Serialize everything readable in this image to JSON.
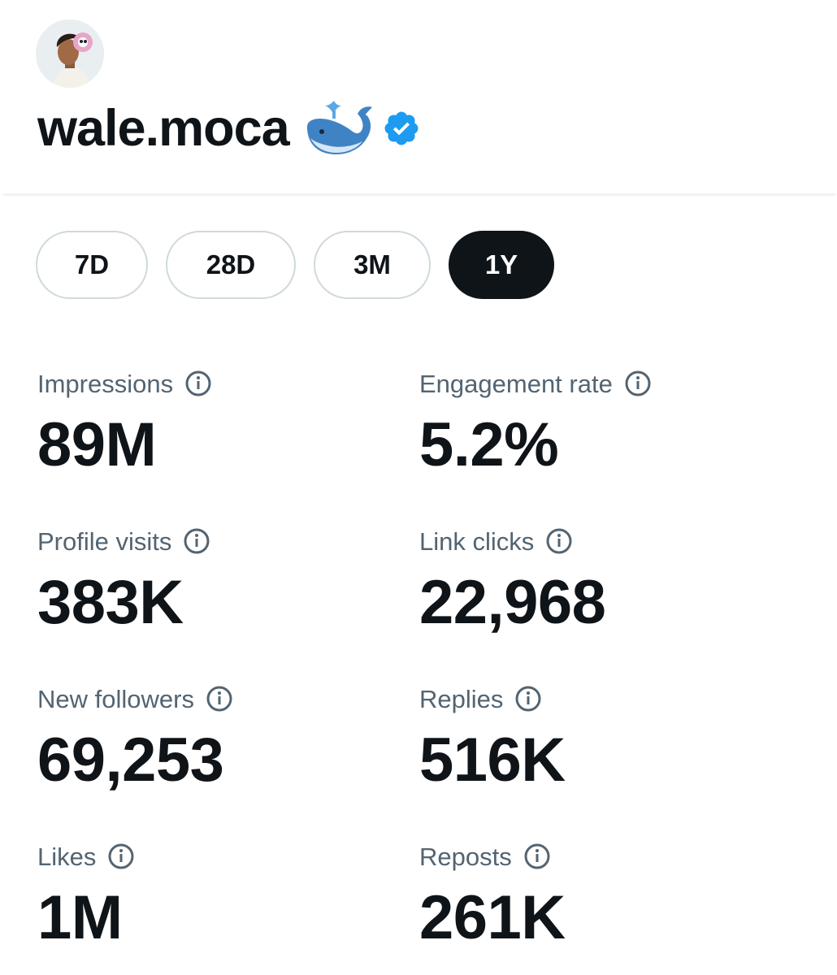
{
  "profile": {
    "username": "wale.moca",
    "emoji_icon": "whale-icon",
    "verified_icon": "verified-badge-icon",
    "verified_color": "#1d9bf0"
  },
  "time_ranges": {
    "options": [
      "7D",
      "28D",
      "3M",
      "1Y"
    ],
    "selected": "1Y"
  },
  "metrics": [
    {
      "label": "Impressions",
      "value": "89M"
    },
    {
      "label": "Engagement rate",
      "value": "5.2%"
    },
    {
      "label": "Profile visits",
      "value": "383K"
    },
    {
      "label": "Link clicks",
      "value": "22,968"
    },
    {
      "label": "New followers",
      "value": "69,253"
    },
    {
      "label": "Replies",
      "value": "516K"
    },
    {
      "label": "Likes",
      "value": "1M"
    },
    {
      "label": "Reposts",
      "value": "261K"
    }
  ],
  "colors": {
    "text_primary": "#0f1419",
    "text_secondary": "#536471",
    "border": "#cfd9de",
    "active_tab_bg": "#0f1419",
    "active_tab_text": "#ffffff"
  }
}
